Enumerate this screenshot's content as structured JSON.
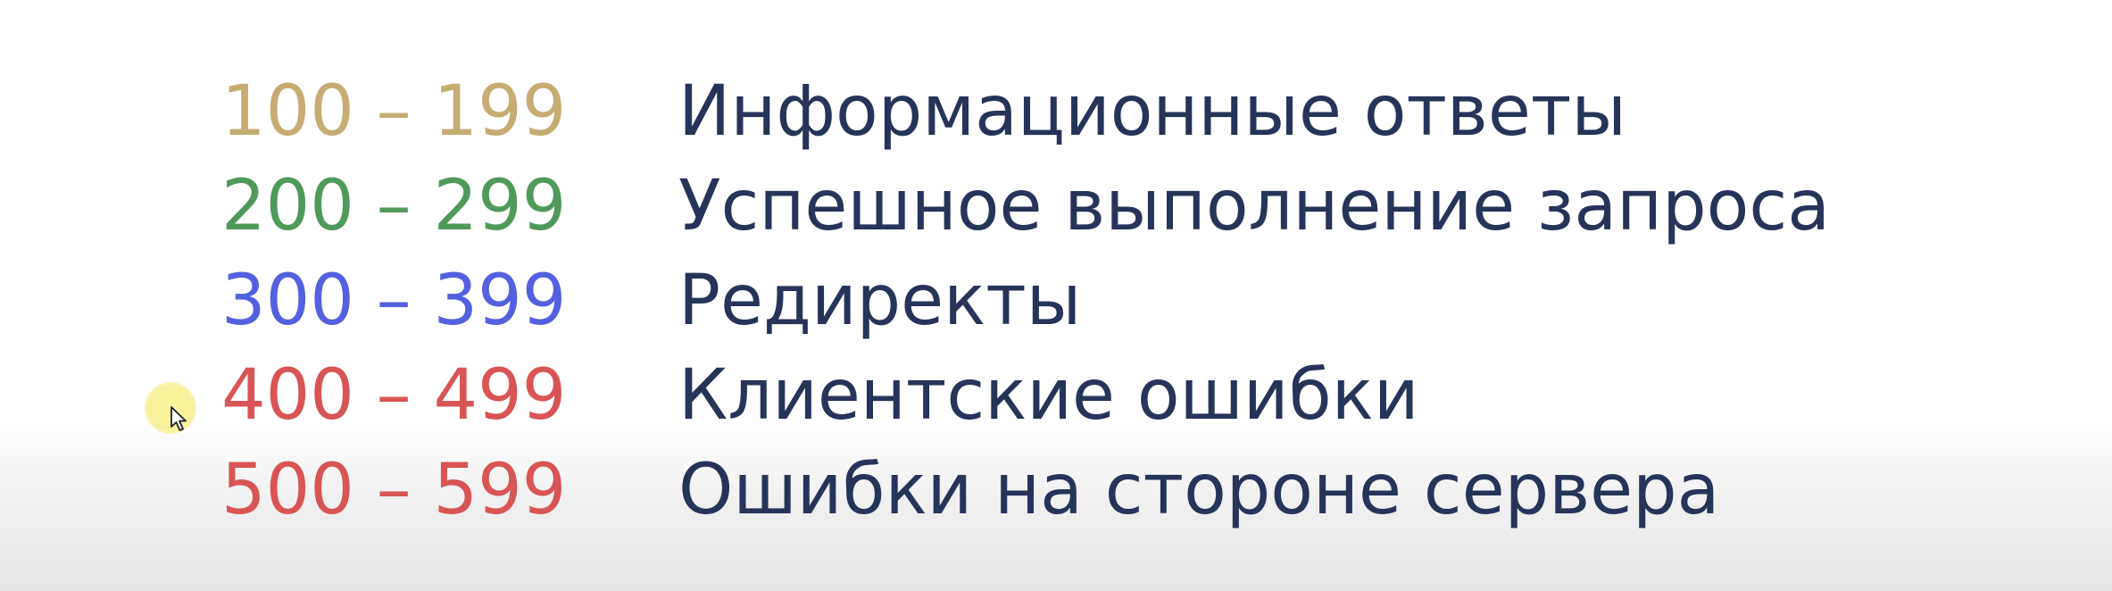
{
  "rows": [
    {
      "range": "100 – 199",
      "description": "Информационные ответы",
      "color": "#c5ac72"
    },
    {
      "range": "200 – 299",
      "description": "Успешное выполнение запроса",
      "color": "#4f9a5a"
    },
    {
      "range": "300 – 399",
      "description": "Редиректы",
      "color": "#5560e0"
    },
    {
      "range": "400 – 499",
      "description": "Клиентские ошибки",
      "color": "#d95454"
    },
    {
      "range": "500 – 599",
      "description": "Ошибки на стороне сервера",
      "color": "#d95454"
    }
  ],
  "description_color": "#26345a",
  "cursor": {
    "icon": "mouse-pointer-icon",
    "highlight_color": "#f7f09a"
  }
}
